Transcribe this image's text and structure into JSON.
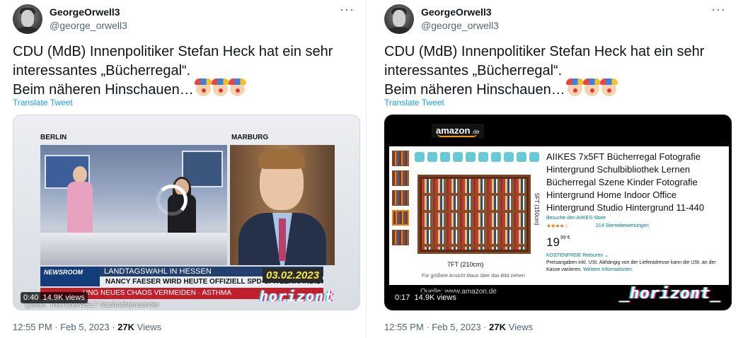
{
  "tweets": [
    {
      "author": {
        "name": "GeorgeOrwell3",
        "handle": "@george_orwell3"
      },
      "text": {
        "line1": "CDU (MdB) Innenpolitiker Stefan Heck hat ein sehr",
        "line2": "interessantes „Bücherregal“.",
        "line3": "Beim näheren Hinschauen…"
      },
      "emoji_count": 3,
      "emoji_icon": "clown-face-emoji",
      "translate_label": "Translate Tweet",
      "video": {
        "location_left": "BERLIN",
        "location_right": "MARBURG",
        "newsroom_label": "NEWSROOM",
        "headline": "LANDTAGSWAHL IN HESSEN",
        "subline": "NANCY FAESER WIRD HEUTE OFFIZIELL SPD-SPITZENKANDIDATIN",
        "red_ticker": "UNG NEUES CHAOS VERMEIDEN · ASTHMA",
        "date_badge": "03.02.2023",
        "watermark": "horizont",
        "source": "Quelle: YouTube/WELT Nachrichtensender",
        "duration": "0:40",
        "views": "14.9K views"
      },
      "time": "12:55 PM · Feb 5, 2023",
      "views_count": "27K",
      "views_label": "Views"
    },
    {
      "author": {
        "name": "GeorgeOrwell3",
        "handle": "@george_orwell3"
      },
      "text": {
        "line1": "CDU (MdB) Innenpolitiker Stefan Heck hat ein sehr",
        "line2": "interessantes „Bücherregal“.",
        "line3": "Beim näheren Hinschauen…"
      },
      "emoji_count": 3,
      "emoji_icon": "clown-face-emoji",
      "translate_label": "Translate Tweet",
      "video": {
        "logo": "amazon",
        "logo_suffix": ".de",
        "product_title": "AIIKES 7x5FT Bücherregal Fotografie Hintergrund Schulbibliothek Lernen Bücherregal Szene Kinder Fotografie Hintergrund Home Indoor Office Hintergrund Studio Hintergrund 11-440",
        "store_link": "Besuche den AIIKES-Store",
        "stars": "★★★★☆",
        "rating_count": "214 Sternebewertungen",
        "price": "19",
        "price_fraction": "99 €",
        "free_returns": "KOSTENFREIE Retouren ⌄",
        "vat_note": "Preisangaben inkl. USt. Abhängig von der Lieferadresse kann die USt. an der Kasse variieren.",
        "more_info": "Weitere Informationen.",
        "size_vertical": "5FT (150cm)",
        "size_horizontal": "7FT (210cm)",
        "hover_hint": "Für größere Ansicht Maus über das Bild ziehen",
        "source": "Quelle: www.amazon.de",
        "watermark": "_horizont_",
        "duration": "0:17",
        "views": "14.9K views"
      },
      "time": "12:55 PM · Feb 5, 2023",
      "views_count": "27K",
      "views_label": "Views"
    }
  ]
}
